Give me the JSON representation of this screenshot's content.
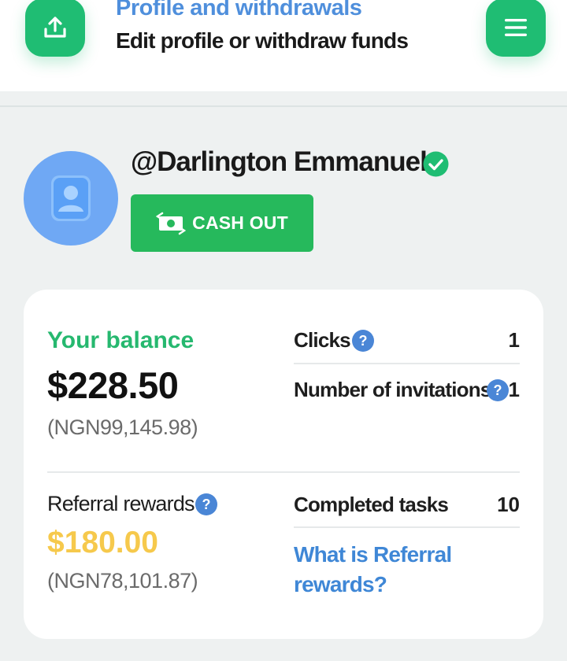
{
  "header": {
    "title": "Profile and withdrawals",
    "subtitle": "Edit profile or withdraw funds",
    "upload_icon": "upload-icon",
    "menu_icon": "menu-icon",
    "accent_color": "#1fbd73"
  },
  "profile": {
    "username": "@Darlington Emmanuel",
    "verified_icon": "check-circle-icon",
    "avatar_icon": "user-card-icon",
    "cashout_label": "CASH OUT",
    "cashout_icon": "money-exchange-icon"
  },
  "balance": {
    "label": "Your balance",
    "value": "$228.50",
    "local": "(NGN99,145.98)"
  },
  "referral": {
    "label": "Referral rewards",
    "value": "$180.00",
    "local": "(NGN78,101.87)",
    "link": "What is Referral rewards?"
  },
  "stats": {
    "clicks_label": "Clicks",
    "clicks_value": "1",
    "invitations_label": "Number of invitations",
    "invitations_value": "1",
    "tasks_label": "Completed tasks",
    "tasks_value": "10",
    "help_glyph": "?"
  }
}
